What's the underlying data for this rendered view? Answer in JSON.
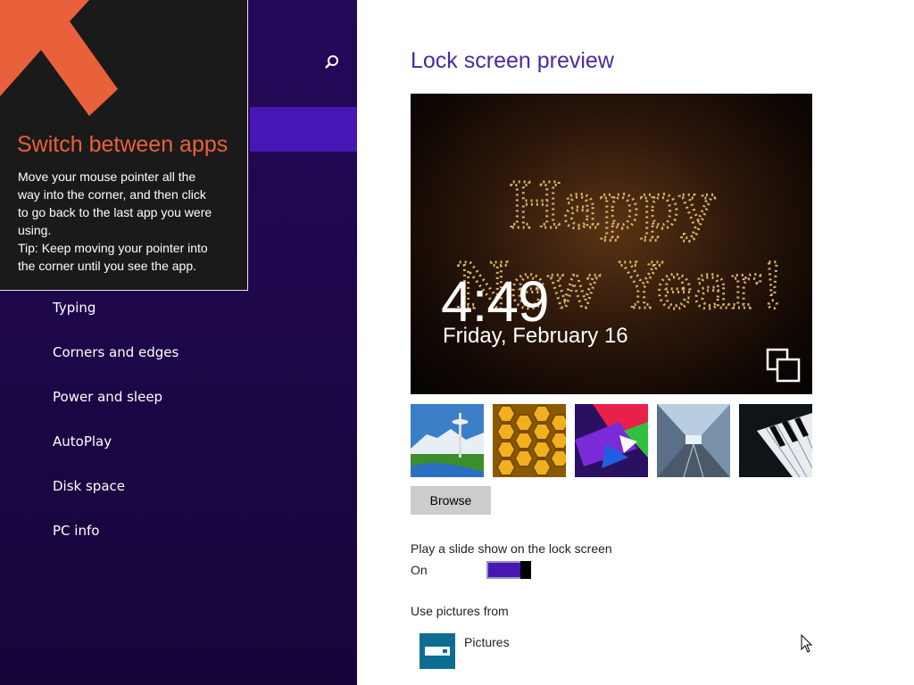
{
  "tip": {
    "title": "Switch between apps",
    "lines": [
      "Move your mouse pointer all the",
      "way into the corner, and then click",
      "to go back to the last app you were",
      "using.",
      "Tip: Keep moving your pointer into",
      "the corner until you see the app."
    ],
    "arrow_color": "#e8613a"
  },
  "sidebar": {
    "search_icon": "search-icon",
    "items": [
      {
        "label": "Typing"
      },
      {
        "label": "Corners and edges"
      },
      {
        "label": "Power and sleep"
      },
      {
        "label": "AutoPlay"
      },
      {
        "label": "Disk space"
      },
      {
        "label": "PC info"
      }
    ],
    "bg_color": "#1e0848",
    "selected_color": "#4617b4"
  },
  "main": {
    "title": "Lock screen preview",
    "preview": {
      "time": "4:49",
      "date": "Friday, February 16",
      "image_text": [
        "Happy",
        "New Year!"
      ]
    },
    "thumbnails": [
      {
        "name": "space-needle"
      },
      {
        "name": "honeycomb"
      },
      {
        "name": "color-shapes"
      },
      {
        "name": "tunnel"
      },
      {
        "name": "piano-keys"
      }
    ],
    "browse_label": "Browse",
    "slideshow": {
      "label": "Play a slide show on the lock screen",
      "state": "On",
      "enabled": true
    },
    "use_pictures_label": "Use pictures from",
    "folder_label": "Pictures",
    "accent_color": "#4617b4",
    "title_color": "#4b2aa0"
  }
}
